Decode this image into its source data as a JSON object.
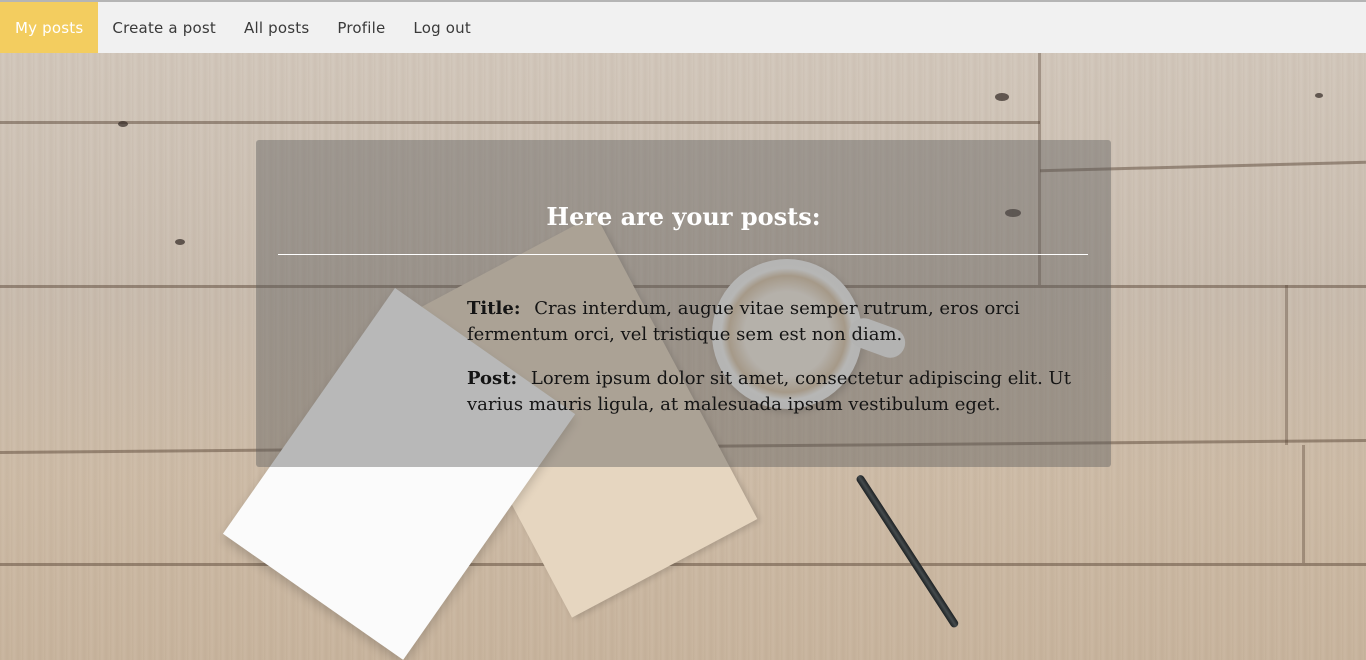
{
  "nav": {
    "items": [
      {
        "label": "My posts",
        "active": true
      },
      {
        "label": "Create a post"
      },
      {
        "label": "All posts"
      },
      {
        "label": "Profile"
      },
      {
        "label": "Log out"
      }
    ],
    "active_color": "#f3cd5f"
  },
  "main": {
    "heading": "Here are your posts:",
    "posts": [
      {
        "title_label": "Title:",
        "title": "Cras interdum, augue vitae semper rutrum, eros orci fermentum orci, vel tristique sem est non diam.",
        "post_label": "Post:",
        "body": "Lorem ipsum dolor sit amet, consectetur adipiscing elit. Ut varius mauris ligula, at malesuada ipsum vestibulum eget."
      }
    ]
  }
}
